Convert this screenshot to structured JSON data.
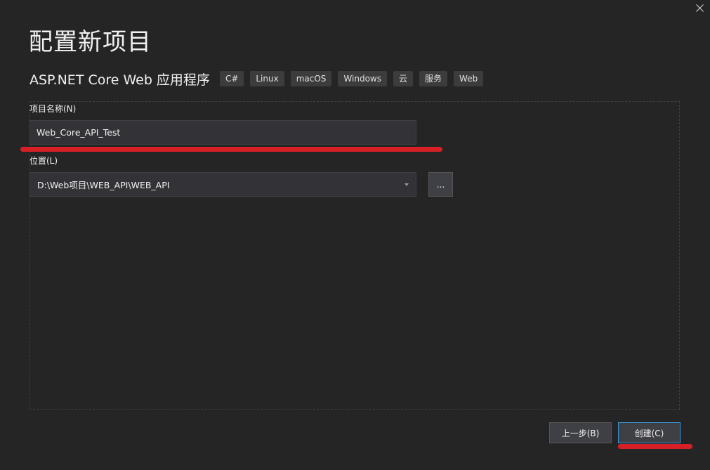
{
  "dialog": {
    "title": "配置新项目",
    "close_icon": "close-icon"
  },
  "template": {
    "name": "ASP.NET Core Web 应用程序",
    "tags": [
      "C#",
      "Linux",
      "macOS",
      "Windows",
      "云",
      "服务",
      "Web"
    ]
  },
  "form": {
    "project_name_label": "项目名称(N)",
    "project_name_value": "Web_Core_API_Test",
    "location_label": "位置(L)",
    "location_value": "D:\\Web项目\\WEB_API\\WEB_API",
    "browse_label": "..."
  },
  "footer": {
    "back_label": "上一步(B)",
    "create_label": "创建(C)"
  },
  "colors": {
    "background": "#252526",
    "input_background": "#333337",
    "button_background": "#3f3f46",
    "primary_border": "#3794d6",
    "annotation_red": "#d62026"
  }
}
